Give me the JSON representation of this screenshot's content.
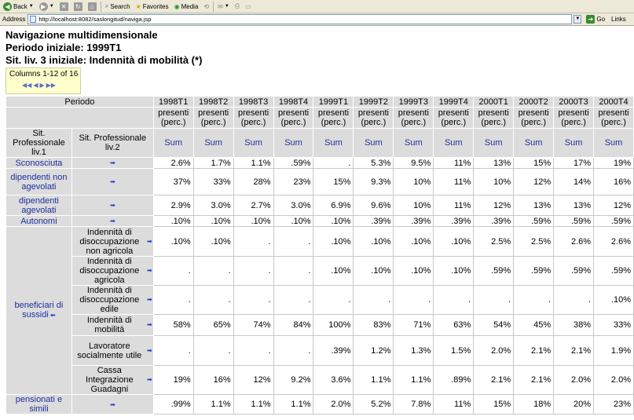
{
  "browser": {
    "back": "Back",
    "search": "Search",
    "favorites": "Favorites",
    "media": "Media",
    "address_label": "Address",
    "url": "http://localhost:8082/saslongitud/naviga.jsp",
    "go": "Go",
    "links": "Links"
  },
  "page": {
    "title": "Navigazione multidimensionale",
    "period_line": "Periodo iniziale: 1999T1",
    "sit_line": "Sit. liv. 3 iniziale: Indennità di mobilità (*)",
    "columns_info": "Columns 1-12 of 16"
  },
  "table": {
    "periodo_label": "Periodo",
    "level1_label": "Sit. Professionale liv.1",
    "level2_label": "Sit. Professionale liv.2",
    "columns": [
      "1998T1",
      "1998T2",
      "1998T3",
      "1998T4",
      "1999T1",
      "1999T2",
      "1999T3",
      "1999T4",
      "2000T1",
      "2000T2",
      "2000T3",
      "2000T4"
    ],
    "measure": "presenti (perc.)",
    "sum": "Sum",
    "rows": [
      {
        "l1": "Sconosciuta",
        "l2": "",
        "values": [
          "2.6%",
          "1.7%",
          "1.1%",
          ".59%",
          ".",
          "5.3%",
          "9.5%",
          "11%",
          "13%",
          "15%",
          "17%",
          "19%"
        ]
      },
      {
        "l1": "dipendenti non agevolati",
        "l2": "",
        "values": [
          "37%",
          "33%",
          "28%",
          "23%",
          "15%",
          "9.3%",
          "10%",
          "11%",
          "10%",
          "12%",
          "14%",
          "16%"
        ]
      },
      {
        "l1": "dipendenti agevolati",
        "l2": "",
        "values": [
          "2.9%",
          "3.0%",
          "2.7%",
          "3.0%",
          "6.9%",
          "9.6%",
          "10%",
          "11%",
          "12%",
          "13%",
          "13%",
          "12%"
        ]
      },
      {
        "l1": "Autonomi",
        "l2": "",
        "values": [
          ".10%",
          ".10%",
          ".10%",
          ".10%",
          ".10%",
          ".39%",
          ".39%",
          ".39%",
          ".39%",
          ".59%",
          ".59%",
          ".59%"
        ]
      },
      {
        "l1": "beneficiari di sussidi",
        "l2": "Indennità di disoccupazione non agricola",
        "values": [
          ".10%",
          ".10%",
          ".",
          ".",
          ".10%",
          ".10%",
          ".10%",
          ".10%",
          "2.5%",
          "2.5%",
          "2.6%",
          "2.6%"
        ]
      },
      {
        "l1": "",
        "l2": "Indennità di disoccupazione agricola",
        "values": [
          ".",
          ".",
          ".",
          ".",
          ".10%",
          ".10%",
          ".10%",
          ".10%",
          ".59%",
          ".59%",
          ".59%",
          ".59%"
        ]
      },
      {
        "l1": "",
        "l2": "Indennità di disoccupazione edile",
        "values": [
          ".",
          ".",
          ".",
          ".",
          ".",
          ".",
          ".",
          ".",
          ".",
          ".",
          ".",
          ".10%"
        ]
      },
      {
        "l1": "",
        "l2": "Indennità di mobilità",
        "values": [
          "58%",
          "65%",
          "74%",
          "84%",
          "100%",
          "83%",
          "71%",
          "63%",
          "54%",
          "45%",
          "38%",
          "33%"
        ]
      },
      {
        "l1": "",
        "l2": "Lavoratore socialmente utile",
        "values": [
          ".",
          ".",
          ".",
          ".",
          ".39%",
          "1.2%",
          "1.3%",
          "1.5%",
          "2.0%",
          "2.1%",
          "2.1%",
          "1.9%"
        ]
      },
      {
        "l1": "",
        "l2": "Cassa Integrazione Guadagni",
        "values": [
          "19%",
          "16%",
          "12%",
          "9.2%",
          "3.6%",
          "1.1%",
          "1.1%",
          ".89%",
          "2.1%",
          "2.1%",
          "2.0%",
          "2.0%"
        ]
      },
      {
        "l1": "pensionati e simili",
        "l2": "",
        "values": [
          ".99%",
          "1.1%",
          "1.1%",
          "1.1%",
          "2.0%",
          "5.2%",
          "7.8%",
          "11%",
          "15%",
          "18%",
          "20%",
          "23%"
        ]
      }
    ]
  }
}
